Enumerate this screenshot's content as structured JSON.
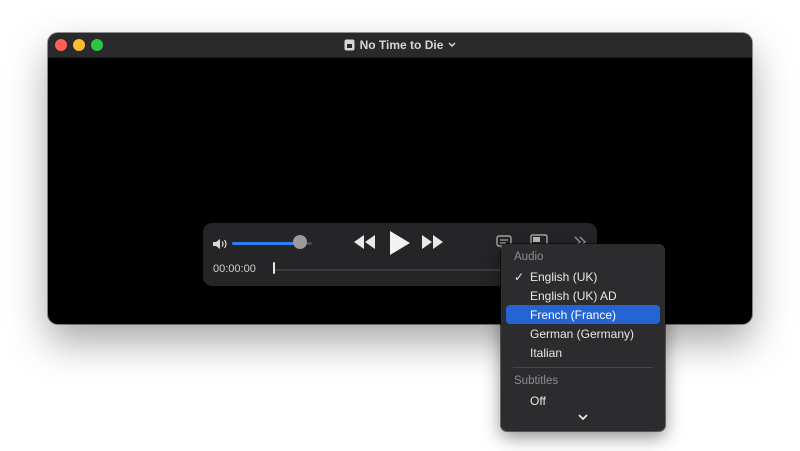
{
  "window": {
    "title": "No Time to Die",
    "title_icon": "document-icon",
    "title_chevron": "chevron-down-icon"
  },
  "controls": {
    "volume_icon": "speaker-icon",
    "volume_level": 0.85,
    "rewind_icon": "rewind-icon",
    "play_icon": "play-icon",
    "fast_forward_icon": "fast-forward-icon",
    "subtitles_icon": "speech-bubble-icon",
    "pip_icon": "picture-in-picture-icon",
    "more_icon": "double-chevron-right-icon",
    "time": "00:00:00",
    "progress": 0
  },
  "menu": {
    "audio_header": "Audio",
    "audio_items": [
      {
        "label": "English (UK)",
        "checked": true,
        "highlighted": false
      },
      {
        "label": "English (UK) AD",
        "checked": false,
        "highlighted": false
      },
      {
        "label": "French (France)",
        "checked": false,
        "highlighted": true
      },
      {
        "label": "German (Germany)",
        "checked": false,
        "highlighted": false
      },
      {
        "label": "Italian",
        "checked": false,
        "highlighted": false
      }
    ],
    "check_mark": "✓",
    "subtitles_header": "Subtitles",
    "subtitle_items": [
      {
        "label": "Off"
      }
    ],
    "scroll_icon": "chevron-down-icon"
  },
  "colors": {
    "accent": "#2f7df6",
    "menu_highlight": "#2464d3",
    "close": "#ff5f57",
    "minimize": "#febc2e",
    "zoom": "#28c840"
  }
}
